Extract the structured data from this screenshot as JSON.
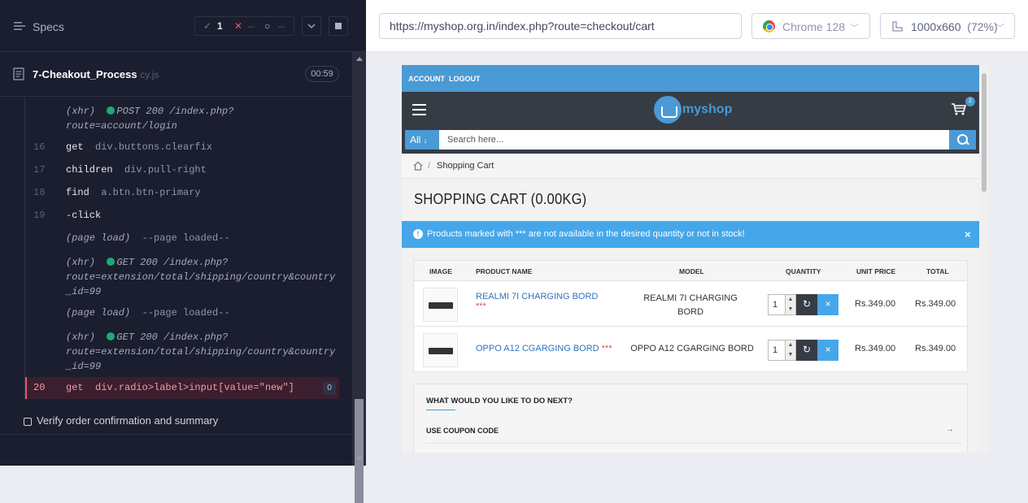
{
  "runner": {
    "specs_label": "Specs",
    "stats": {
      "passed": "1",
      "failed": "--",
      "pending": "--"
    },
    "spec_file": {
      "name": "7-Cheakout_Process",
      "ext": "cy.js",
      "duration": "00:59"
    },
    "log": [
      {
        "num": "",
        "type": "xhr",
        "text": "(xhr)",
        "method": "POST 200 /index.php?",
        "cont": "route=account/login"
      },
      {
        "num": "16",
        "type": "cmd",
        "cmd": "get",
        "arg": "div.buttons.clearfix"
      },
      {
        "num": "17",
        "type": "cmd",
        "cmd": "children",
        "arg": "div.pull-right"
      },
      {
        "num": "18",
        "type": "cmd",
        "cmd": "find",
        "arg": "a.btn.btn-primary"
      },
      {
        "num": "19",
        "type": "cmd",
        "cmd": "-click",
        "arg": ""
      },
      {
        "num": "",
        "type": "event",
        "text": "(page load)",
        "arg": "--page loaded--"
      },
      {
        "num": "",
        "type": "xhr",
        "text": "(xhr)",
        "method": "GET 200 /index.php?",
        "cont": "route=extension/total/shipping/country&country",
        "cont2": "_id=99"
      },
      {
        "num": "",
        "type": "event",
        "text": "(page load)",
        "arg": "--page loaded--"
      },
      {
        "num": "",
        "type": "xhr",
        "text": "(xhr)",
        "method": "GET 200 /index.php?",
        "cont": "route=extension/total/shipping/country&country",
        "cont2": "_id=99"
      }
    ],
    "error_line": {
      "num": "20",
      "cmd": "get",
      "arg": "div.radio>label>input[value=\"new\"]",
      "count": "0"
    },
    "pending_test": "Verify order confirmation and summary"
  },
  "browser": {
    "url": "https://myshop.org.in/index.php?route=checkout/cart",
    "name": "Chrome 128",
    "viewport": "1000x660",
    "zoom": "(72%)"
  },
  "site": {
    "top_links": [
      "ACCOUNT",
      "LOGOUT"
    ],
    "logo_text": "myshop",
    "cart_count": "2",
    "search": {
      "category": "All",
      "placeholder": "Search here..."
    },
    "breadcrumb": "Shopping Cart",
    "heading": "SHOPPING CART  (0.00KG)",
    "alert": "Products marked with *** are not available in the desired quantity or not in stock!",
    "table": {
      "headers": [
        "IMAGE",
        "PRODUCT NAME",
        "MODEL",
        "QUANTITY",
        "UNIT PRICE",
        "TOTAL"
      ],
      "rows": [
        {
          "name": "REALMI 7I CHARGING BORD",
          "stars": "***",
          "model_1": "REALMI 7I CHARGING",
          "model_2": "BORD",
          "qty": "1",
          "unit": "Rs.349.00",
          "total": "Rs.349.00"
        },
        {
          "name": "OPPO A12 CGARGING BORD",
          "stars": "***",
          "model_1": "OPPO A12 CGARGING BORD",
          "model_2": "",
          "qty": "1",
          "unit": "Rs.349.00",
          "total": "Rs.349.00"
        }
      ]
    },
    "next": {
      "heading": "WHAT WOULD YOU LIKE TO DO NEXT?",
      "coupon": "USE COUPON CODE",
      "arrow": "→"
    }
  }
}
